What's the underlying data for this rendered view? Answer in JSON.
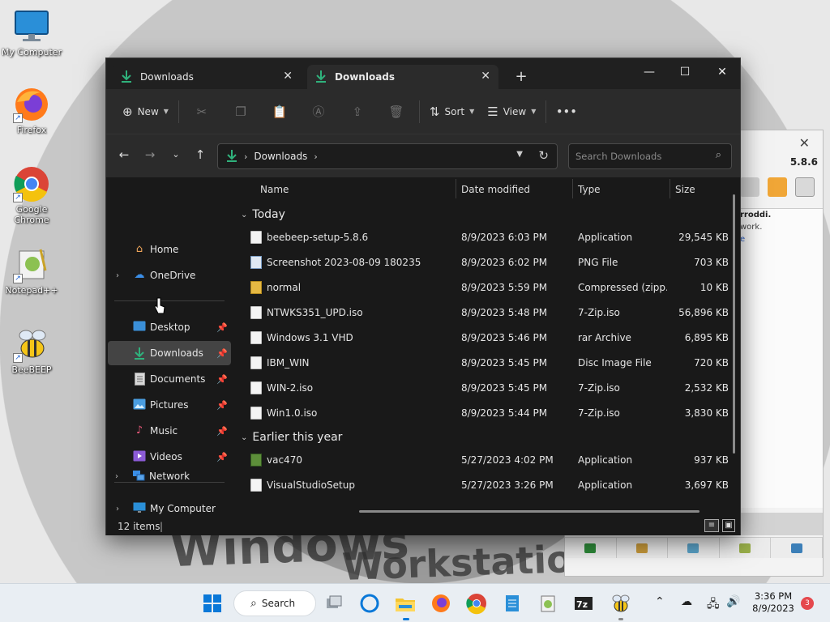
{
  "desktop": {
    "icons": [
      {
        "label": "My Computer"
      },
      {
        "label": "Firefox"
      },
      {
        "label": "Google Chrome"
      },
      {
        "label": "Notepad++"
      },
      {
        "label": "BeeBEEP"
      }
    ],
    "wallpaper_text": {
      "line1": "Windows",
      "line2": "Workstatio"
    }
  },
  "bg_window": {
    "version": "5.8.6",
    "lines": [
      "rroddi.",
      "work.",
      "e"
    ]
  },
  "explorer": {
    "tabs": [
      {
        "label": "Downloads"
      },
      {
        "label": "Downloads"
      }
    ],
    "window_buttons": {
      "minimize": "—",
      "maximize": "☐",
      "close": "✕"
    },
    "commands": {
      "new_label": "New",
      "sort_label": "Sort",
      "view_label": "View",
      "more_label": "•••"
    },
    "address": {
      "path": "Downloads"
    },
    "search": {
      "placeholder": "Search Downloads"
    },
    "nav": {
      "home": "Home",
      "onedrive": "OneDrive",
      "desktop": "Desktop",
      "downloads": "Downloads",
      "documents": "Documents",
      "pictures": "Pictures",
      "music": "Music",
      "videos": "Videos",
      "my_computer": "My Computer",
      "network": "Network"
    },
    "columns": {
      "name": "Name",
      "date": "Date modified",
      "type": "Type",
      "size": "Size"
    },
    "groups": {
      "today": "Today",
      "earlier": "Earlier this year"
    },
    "files_today": [
      {
        "name": "beebeep-setup-5.8.6",
        "date": "8/9/2023 6:03 PM",
        "type": "Application",
        "size": "29,545 KB",
        "icon": "document-icon"
      },
      {
        "name": "Screenshot 2023-08-09 180235",
        "date": "8/9/2023 6:02 PM",
        "type": "PNG File",
        "size": "703 KB",
        "icon": "image-file-icon"
      },
      {
        "name": "normal",
        "date": "8/9/2023 5:59 PM",
        "type": "Compressed (zipp...",
        "size": "10 KB",
        "icon": "zip-folder-icon"
      },
      {
        "name": "NTWKS351_UPD.iso",
        "date": "8/9/2023 5:48 PM",
        "type": "7-Zip.iso",
        "size": "56,896 KB",
        "icon": "document-icon"
      },
      {
        "name": "Windows 3.1 VHD",
        "date": "8/9/2023 5:46 PM",
        "type": "rar Archive",
        "size": "6,895 KB",
        "icon": "document-icon"
      },
      {
        "name": "IBM_WIN",
        "date": "8/9/2023 5:45 PM",
        "type": "Disc Image File",
        "size": "720 KB",
        "icon": "document-icon"
      },
      {
        "name": "WIN-2.iso",
        "date": "8/9/2023 5:45 PM",
        "type": "7-Zip.iso",
        "size": "2,532 KB",
        "icon": "document-icon"
      },
      {
        "name": "Win1.0.iso",
        "date": "8/9/2023 5:44 PM",
        "type": "7-Zip.iso",
        "size": "3,830 KB",
        "icon": "document-icon"
      }
    ],
    "files_earlier": [
      {
        "name": "vac470",
        "date": "5/27/2023 4:02 PM",
        "type": "Application",
        "size": "937 KB",
        "icon": "application-icon"
      },
      {
        "name": "VisualStudioSetup",
        "date": "5/27/2023 3:26 PM",
        "type": "Application",
        "size": "3,697 KB",
        "icon": "document-icon"
      }
    ],
    "status": {
      "count": "12 items",
      "separator": "|"
    }
  },
  "taskbar": {
    "search_label": "Search",
    "clock_time": "3:36 PM",
    "clock_date": "8/9/2023",
    "notifications": "3"
  },
  "colors": {
    "explorer_bg": "#191919",
    "toolbar_bg": "#2b2b2b",
    "accent_download": "#2fb27c",
    "taskbar_bg": "#e9eef3"
  }
}
